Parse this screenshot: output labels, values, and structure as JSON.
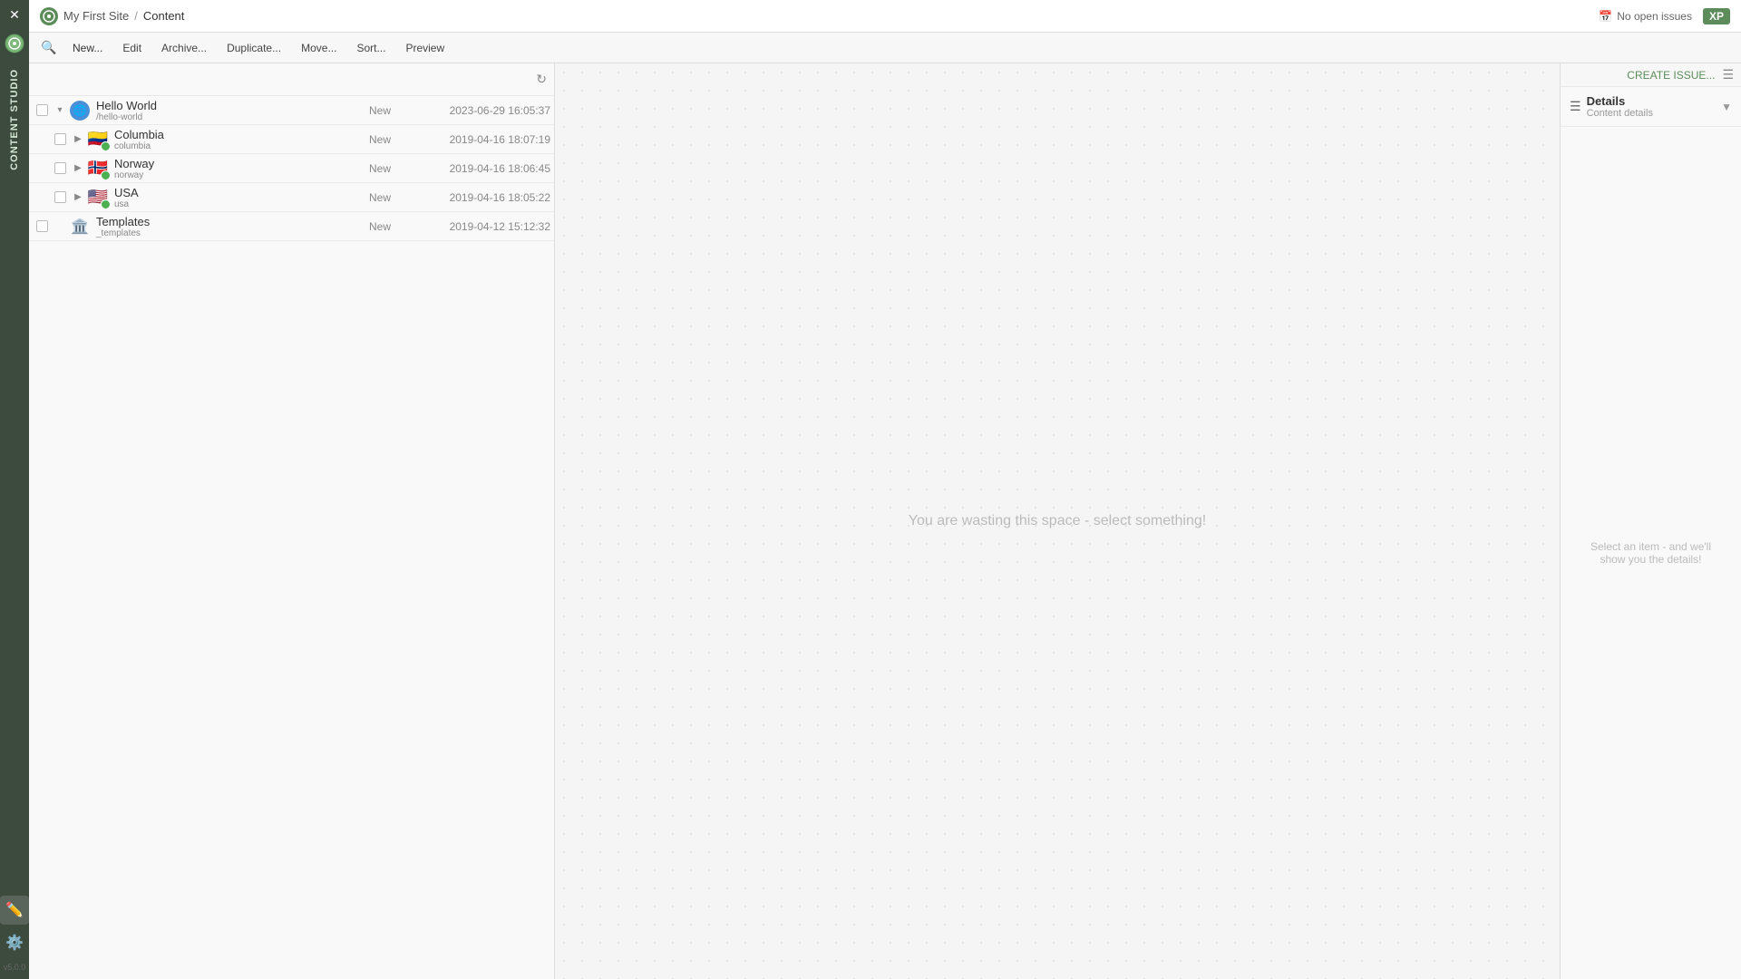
{
  "app": {
    "close_icon": "✕",
    "logo_icon": "🎯",
    "version": "v5.0.0",
    "vertical_label": "CONTENT STUDIO"
  },
  "header": {
    "site_name": "My First Site",
    "breadcrumb_sep": "/",
    "current_page": "Content",
    "no_issues_label": "No open issues",
    "xp_label": "XP"
  },
  "toolbar": {
    "search_icon": "🔍",
    "new_label": "New...",
    "edit_label": "Edit",
    "archive_label": "Archive...",
    "duplicate_label": "Duplicate...",
    "move_label": "Move...",
    "sort_label": "Sort...",
    "preview_label": "Preview"
  },
  "create_issue_bar": {
    "link_label": "CREATE ISSUE...",
    "view_toggle_icon": "☰"
  },
  "tree": {
    "refresh_icon": "↻",
    "items": [
      {
        "id": "hello-world",
        "name": "Hello World",
        "path": "/hello-world",
        "icon_type": "globe",
        "has_badge": false,
        "expanded": true,
        "indent": 0,
        "status": "New",
        "date": "2023-06-29 16:05:37"
      },
      {
        "id": "columbia",
        "name": "Columbia",
        "path": "columbia",
        "icon_type": "flag_co",
        "has_badge": true,
        "expanded": false,
        "indent": 1,
        "status": "New",
        "date": "2019-04-16 18:07:19"
      },
      {
        "id": "norway",
        "name": "Norway",
        "path": "norway",
        "icon_type": "flag_no",
        "has_badge": true,
        "expanded": false,
        "indent": 1,
        "status": "New",
        "date": "2019-04-16 18:06:45"
      },
      {
        "id": "usa",
        "name": "USA",
        "path": "usa",
        "icon_type": "flag_us",
        "has_badge": true,
        "expanded": false,
        "indent": 1,
        "status": "New",
        "date": "2019-04-16 18:05:22"
      },
      {
        "id": "templates",
        "name": "Templates",
        "path": "_templates",
        "icon_type": "templates",
        "has_badge": false,
        "expanded": false,
        "indent": 0,
        "status": "New",
        "date": "2019-04-12 15:12:32"
      }
    ]
  },
  "empty_area": {
    "message": "You are wasting this space - select something!"
  },
  "details_panel": {
    "icon": "☰",
    "title": "Details",
    "subtitle": "Content details",
    "chevron": "▼",
    "empty_message": "Select an item - and we'll show you the details!"
  }
}
